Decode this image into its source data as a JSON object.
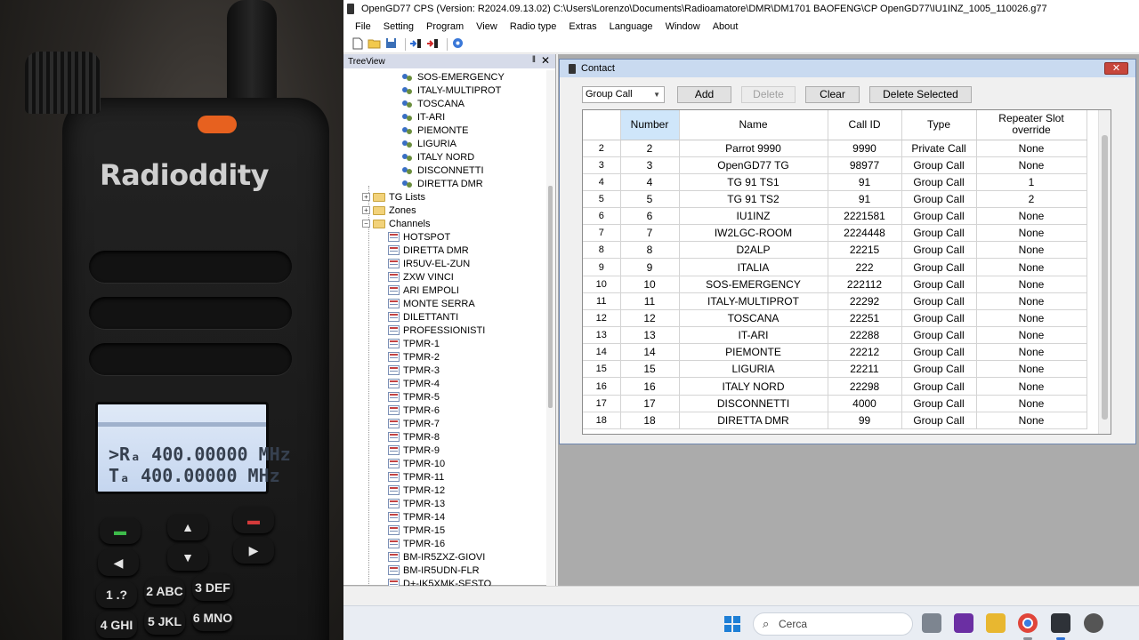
{
  "window": {
    "title": "OpenGD77 CPS (Version: R2024.09.13.02) C:\\Users\\Lorenzo\\Documents\\Radioamatore\\DMR\\DM1701 BAOFENG\\CP OpenGD77\\IU1INZ_1005_110026.g77"
  },
  "menu": [
    "File",
    "Setting",
    "Program",
    "View",
    "Radio type",
    "Extras",
    "Language",
    "Window",
    "About"
  ],
  "toolbar_icons": [
    "new-file-icon",
    "open-folder-icon",
    "save-icon",
    "read-radio-icon",
    "write-radio-icon",
    "help-icon"
  ],
  "treeview": {
    "title": "TreeView",
    "pin_glyph": "‖",
    "close_glyph": "✕",
    "contacts": [
      "SOS-EMERGENCY",
      "ITALY-MULTIPROT",
      "TOSCANA",
      "IT-ARI",
      "PIEMONTE",
      "LIGURIA",
      "ITALY NORD",
      "DISCONNETTI",
      "DIRETTA DMR"
    ],
    "folders": [
      {
        "label": "TG Lists",
        "expander": "+"
      },
      {
        "label": "Zones",
        "expander": "+"
      },
      {
        "label": "Channels",
        "expander": "−"
      }
    ],
    "channels": [
      "HOTSPOT",
      "DIRETTA DMR",
      "IR5UV-EL-ZUN",
      "ZXW VINCI",
      "ARI EMPOLI",
      "MONTE SERRA",
      "DILETTANTI",
      "PROFESSIONISTI",
      "TPMR-1",
      "TPMR-2",
      "TPMR-3",
      "TPMR-4",
      "TPMR-5",
      "TPMR-6",
      "TPMR-7",
      "TPMR-8",
      "TPMR-9",
      "TPMR-10",
      "TPMR-11",
      "TPMR-12",
      "TPMR-13",
      "TPMR-14",
      "TPMR-15",
      "TPMR-16",
      "BM-IR5ZXZ-GIOVI",
      "BM-IR5UDN-FLR",
      "D+-IK5XMK-SESTO"
    ]
  },
  "contact_window": {
    "title": "Contact",
    "close_glyph": "✕",
    "filter_value": "Group Call",
    "filter_arrow": "⌵",
    "buttons": {
      "add": "Add",
      "delete": "Delete",
      "clear": "Clear",
      "delete_selected": "Delete Selected"
    },
    "columns": [
      "Number",
      "Name",
      "Call ID",
      "Type",
      "Repeater Slot override"
    ],
    "rows": [
      [
        "2",
        "2",
        "Parrot 9990",
        "9990",
        "Private Call",
        "None"
      ],
      [
        "3",
        "3",
        "OpenGD77 TG",
        "98977",
        "Group Call",
        "None"
      ],
      [
        "4",
        "4",
        "TG 91 TS1",
        "91",
        "Group Call",
        "1"
      ],
      [
        "5",
        "5",
        "TG 91 TS2",
        "91",
        "Group Call",
        "2"
      ],
      [
        "6",
        "6",
        "IU1INZ",
        "2221581",
        "Group Call",
        "None"
      ],
      [
        "7",
        "7",
        "IW2LGC-ROOM",
        "2224448",
        "Group Call",
        "None"
      ],
      [
        "8",
        "8",
        "D2ALP",
        "22215",
        "Group Call",
        "None"
      ],
      [
        "9",
        "9",
        "ITALIA",
        "222",
        "Group Call",
        "None"
      ],
      [
        "10",
        "10",
        "SOS-EMERGENCY",
        "222112",
        "Group Call",
        "None"
      ],
      [
        "11",
        "11",
        "ITALY-MULTIPROT",
        "22292",
        "Group Call",
        "None"
      ],
      [
        "12",
        "12",
        "TOSCANA",
        "22251",
        "Group Call",
        "None"
      ],
      [
        "13",
        "13",
        "IT-ARI",
        "22288",
        "Group Call",
        "None"
      ],
      [
        "14",
        "14",
        "PIEMONTE",
        "22212",
        "Group Call",
        "None"
      ],
      [
        "15",
        "15",
        "LIGURIA",
        "22211",
        "Group Call",
        "None"
      ],
      [
        "16",
        "16",
        "ITALY NORD",
        "22298",
        "Group Call",
        "None"
      ],
      [
        "17",
        "17",
        "DISCONNETTI",
        "4000",
        "Group Call",
        "None"
      ],
      [
        "18",
        "18",
        "DIRETTA DMR",
        "99",
        "Group Call",
        "None"
      ]
    ]
  },
  "taskbar": {
    "search_placeholder": "Cerca",
    "search_glyph": "⌕",
    "apps": [
      "task-view-icon",
      "app-icon",
      "file-explorer-icon",
      "chrome-icon",
      "radio-cps-icon",
      "settings-icon"
    ]
  },
  "photo": {
    "brand": "Radioddity",
    "lcd_line1": ">Rₐ 400.00000 MHz",
    "lcd_line2": " Tₐ 400.00000 MHz",
    "keys": [
      "1 .?",
      "2 ABC",
      "3 DEF",
      "4 GHI",
      "5 JKL",
      "6 MNO"
    ]
  }
}
